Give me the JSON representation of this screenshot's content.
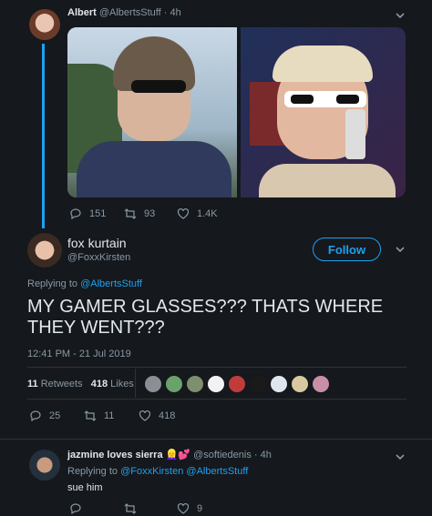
{
  "tweet1": {
    "display_name": "Albert",
    "handle": "@AlbertsStuff",
    "time": "· 4h",
    "reply_count": "151",
    "retweet_count": "93",
    "like_count": "1.4K"
  },
  "main": {
    "display_name": "fox kurtain",
    "handle": "@FoxxKirsten",
    "follow_label": "Follow",
    "replying_prefix": "Replying to",
    "replying_to": "@AlbertsStuff",
    "text": "MY GAMER GLASSES??? THATS WHERE THEY WENT???",
    "timestamp": "12:41 PM - 21 Jul 2019",
    "retweets_num": "11",
    "retweets_label": "Retweets",
    "likes_num": "418",
    "likes_label": "Likes",
    "reply_count": "25",
    "retweet_count": "11",
    "like_count": "418"
  },
  "reply": {
    "display_name": "jazmine loves sierra",
    "emoji": "👱‍♀️💕",
    "handle": "@softiedenis",
    "time": "· 4h",
    "replying_prefix": "Replying to",
    "replying_to_1": "@FoxxKirsten",
    "replying_to_2": "@AlbertsStuff",
    "text": "sue him",
    "like_count": "9"
  },
  "colors": {
    "background": "#15181c",
    "accent": "#1da1f2",
    "muted": "#8899a6",
    "divider": "#2f3336"
  }
}
